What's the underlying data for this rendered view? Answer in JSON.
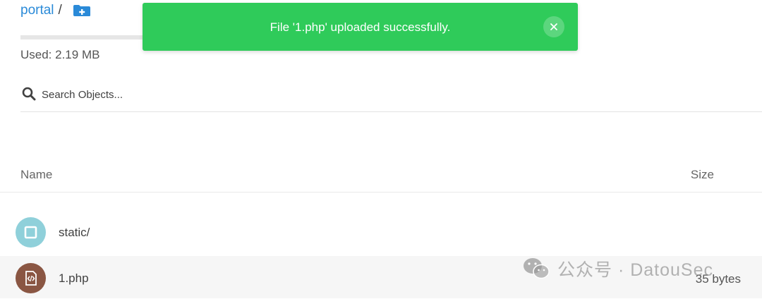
{
  "breadcrumb": {
    "bucket": "portal",
    "separator": "/"
  },
  "storage": {
    "used_label": "Used: 2.19 MB"
  },
  "search": {
    "placeholder": "Search Objects..."
  },
  "table": {
    "columns": [
      "Name",
      "Size"
    ]
  },
  "objects": [
    {
      "name": "static/",
      "type": "folder",
      "size": "",
      "icon": "folder-icon"
    },
    {
      "name": "1.php",
      "type": "file",
      "size": "35 bytes",
      "icon": "code-file-icon"
    }
  ],
  "toast": {
    "message": "File '1.php' uploaded successfully.",
    "color": "#2fcb5a"
  },
  "watermark": {
    "text": "公众号 · DatouSec"
  },
  "colors": {
    "link": "#2a8ad8",
    "folder": "#8fd0da",
    "file": "#8a5643"
  }
}
